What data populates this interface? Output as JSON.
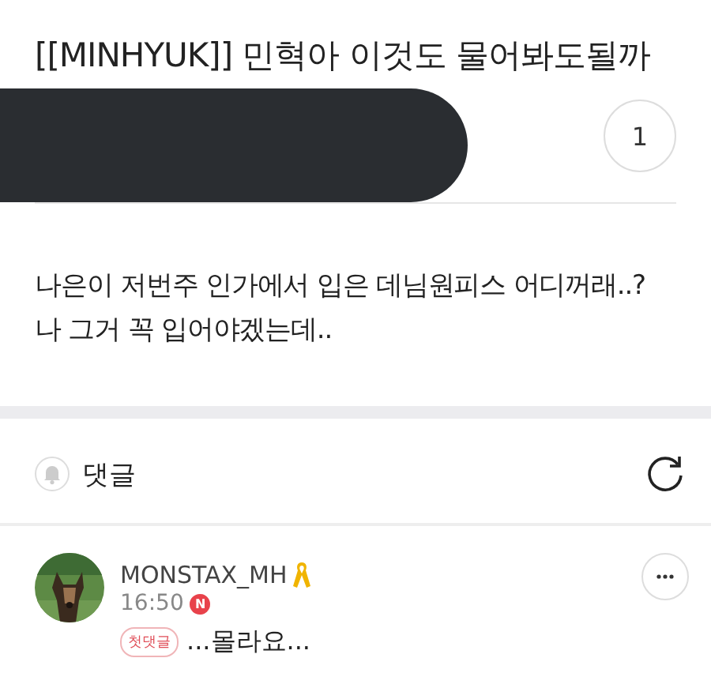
{
  "post": {
    "title": "[[MINHYUK]] 민혁아 이것도 물어봐도될까",
    "comment_count": "1",
    "body_lines": [
      "나은이 저번주 인가에서 입은 데님원피스 어디꺼래..?",
      "나 그거 꼭 입어야겠는데.."
    ]
  },
  "comments_header": {
    "label": "댓글"
  },
  "comments": [
    {
      "author": "MONSTAX_MH",
      "time": "16:50",
      "is_new": true,
      "new_badge": "N",
      "first_comment_tag": "첫댓글",
      "text": "...몰라요..."
    }
  ]
}
